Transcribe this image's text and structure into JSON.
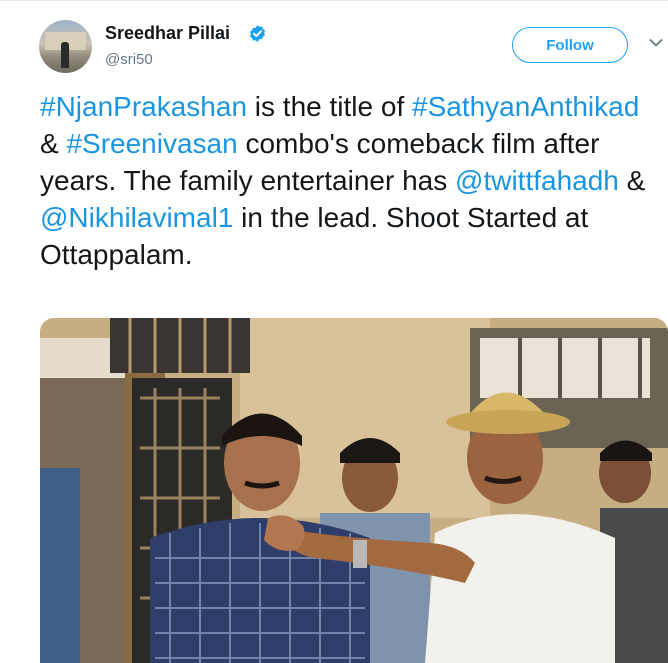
{
  "user": {
    "display_name": "Sreedhar Pillai",
    "handle": "@sri50",
    "verified_icon": "verified-badge-icon",
    "avatar_icon": "avatar-photo"
  },
  "follow_button": {
    "label": "Follow"
  },
  "menu": {
    "icon": "chevron-down-icon"
  },
  "tweet": {
    "parts": [
      {
        "t": "#NjanPrakashan",
        "kind": "tag"
      },
      {
        "t": " is the title of ",
        "kind": "text"
      },
      {
        "t": "#SathyanAnthikad",
        "kind": "tag"
      },
      {
        "t": " &  ",
        "kind": "text"
      },
      {
        "t": "#Sreenivasan",
        "kind": "tag"
      },
      {
        "t": " combo's comeback film after years. The family entertainer has ",
        "kind": "text"
      },
      {
        "t": "@twittfahadh",
        "kind": "mention"
      },
      {
        "t": " & ",
        "kind": "text"
      },
      {
        "t": "@Nikhilavimal1",
        "kind": "mention"
      },
      {
        "t": " in the lead. Shoot Started at Ottappalam.",
        "kind": "text"
      }
    ]
  },
  "media": {
    "type": "photo"
  },
  "colors": {
    "link": "#1b95e0",
    "accent": "#1da1f2",
    "text": "#14171a",
    "secondary": "#657786"
  }
}
